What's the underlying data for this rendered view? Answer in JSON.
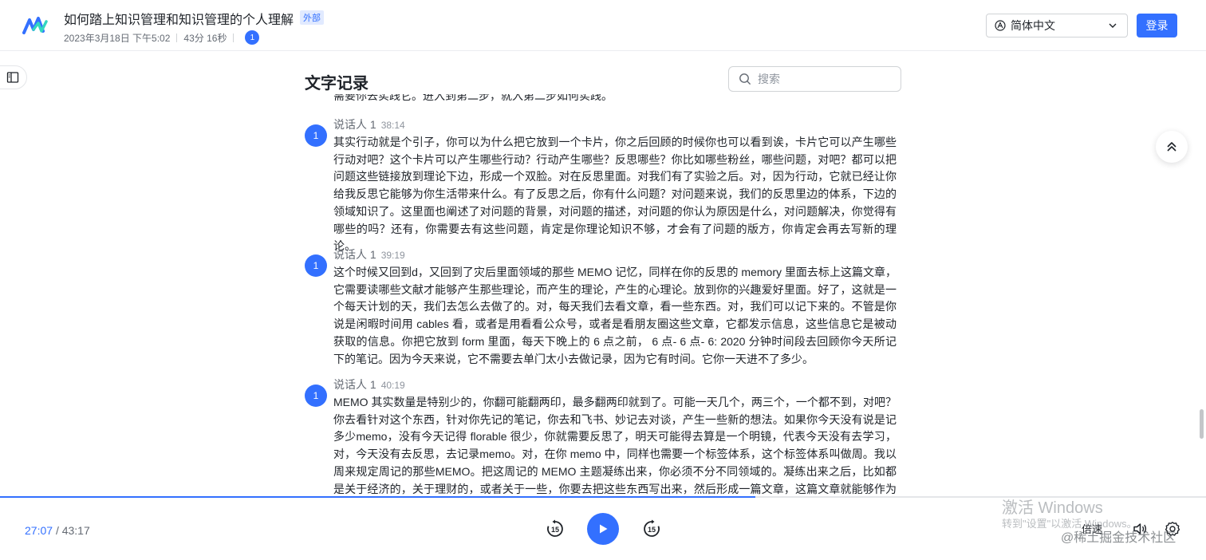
{
  "header": {
    "title": "如何踏上知识管理和知识管理的个人理解",
    "tag": "外部",
    "date": "2023年3月18日 下午5:02",
    "duration": "43分 16秒",
    "participant_badge": "1",
    "language": "简体中文",
    "login_label": "登录"
  },
  "transcript": {
    "title": "文字记录",
    "search_placeholder": "搜索",
    "cut_line": "需要你去实践它。进入到第二步，就入第二步如何实践。",
    "paragraphs": [
      {
        "avatar": "1",
        "speaker": "说话人 1",
        "time": "38:14",
        "text": "其实行动就是个引子，你可以为什么把它放到一个卡片，你之后回顾的时候你也可以看到诶，卡片它可以产生哪些行动对吧？这个卡片可以产生哪些行动？行动产生哪些？反思哪些？你比如哪些粉丝，哪些问题，对吧？都可以把问题这些链接放到理论下边，形成一个双脸。对在反思里面。对我们有了实验之后。对，因为行动，它就已经让你给我反思它能够为你生活带来什么。有了反思之后，你有什么问题？对问题来说，我们的反思里边的体系，下边的领域知识了。这里面也阐述了对问题的背景，对问题的描述，对问题的你认为原因是什么，对问题解决，你觉得有哪些的吗？还有，你需要去有这些问题，肯定是你理论知识不够，才会有了问题的版方，你肯定会再去写新的理论。"
      },
      {
        "avatar": "1",
        "speaker": "说话人 1",
        "time": "39:19",
        "text": "这个时候又回到d，又回到了灾后里面领域的那些 MEMO 记忆，同样在你的反思的 memory 里面去标上这篇文章，它需要读哪些文献才能够产生那些理论，而产生的理论，产生的心理论。放到你的兴趣爱好里面。好了，这就是一个每天计划的天，我们去怎么去做了的。对，每天我们去看文章，看一些东西。对，我们可以记下来的。不管是你说是闲暇时间用 cables 看，或者是用看看公众号，或者是看朋友圈这些文章，它都发示信息，这些信息它是被动获取的信息。你把它放到 form 里面，每天下晚上的 6 点之前， 6 点- 6 点- 6: 2020 分钟时间段去回顾你今天所记下的笔记。因为今天来说，它不需要去单门太小去做记录，因为它有时间。它你一天进不了多少。"
      },
      {
        "avatar": "1",
        "speaker": "说话人 1",
        "time": "40:19",
        "text": "MEMO 其实数量是特别少的，你翻可能翻两印，最多翻两印就到了。可能一天几个，两三个，一个都不到，对吧？你去看针对这个东西，针对你先记的笔记，你去和飞书、妙记去对谈，产生一些新的想法。如果你今天没有说是记多少memo，没有今天记得 florable 很少，你就需要反思了，明天可能得去算是一个明镜，代表今天没有去学习，对，今天没有去反思，去记录memo。对，在你 memo 中，同样也需要一个标签体系，这个标签体系叫做周。我以周来规定周记的那些MEMO。把这周记的 MEMO 主题凝练出来，你必须不分不同领域的。凝练出来之后，比如都是关于经济的，关于理财的，或者关于一些，你要去把这些东西写出来，然后形成一篇文章，这篇文章就能够作为你的周记。"
      }
    ]
  },
  "player": {
    "current_time": "27:07",
    "separator": "/",
    "total_time": "43:17",
    "progress": 0.626,
    "rewind_label": "15",
    "forward_label": "15",
    "speed_label": "倍速"
  },
  "watermarks": {
    "windows_line1": "激活 Windows",
    "windows_line2": "转到\"设置\"以激活 Windows。",
    "juejin": "@稀土掘金技术社区"
  },
  "colors": {
    "accent": "#3370ff",
    "text_primary": "#1f2329",
    "text_secondary": "#646a73"
  },
  "icons": [
    "logo-icon",
    "globe-icon",
    "chevron-down-icon",
    "sidebar-icon",
    "search-icon",
    "scroll-top-icon",
    "rewind-15-icon",
    "play-icon",
    "forward-15-icon",
    "volume-icon",
    "gear-icon"
  ]
}
